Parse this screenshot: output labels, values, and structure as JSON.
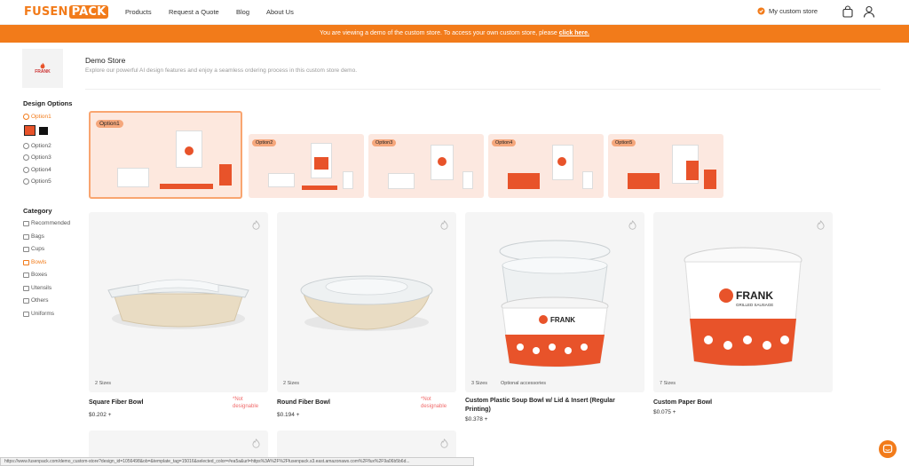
{
  "header": {
    "logo_part1": "FUSEN",
    "logo_part2": "PACK",
    "nav": [
      "Products",
      "Request a Quote",
      "Blog",
      "About Us"
    ],
    "my_store": "My custom store"
  },
  "banner": {
    "text": "You are viewing a demo of the custom store. To access your own custom store, please ",
    "link": "click here."
  },
  "store": {
    "logo_text": "FRANK",
    "title": "Demo Store",
    "subtitle": "Explore our powerful AI design features and enjoy a seamless ordering process in this custom store demo."
  },
  "sidebar": {
    "design_heading": "Design Options",
    "options": [
      "Option1",
      "Option2",
      "Option3",
      "Option4",
      "Option5"
    ],
    "swatches": [
      "#e8532a",
      "#111111"
    ],
    "category_heading": "Category",
    "categories": [
      "Recommended",
      "Bags",
      "Cups",
      "Bowls",
      "Boxes",
      "Utensils",
      "Others",
      "Uniforms"
    ],
    "active_category": "Bowls"
  },
  "designs": [
    "Option1",
    "Option2",
    "Option3",
    "Option4",
    "Option5"
  ],
  "products": [
    {
      "name": "Square Fiber Bowl",
      "price": "$0.202 +",
      "sizes": "2 Sizes",
      "note1": "*Not",
      "note2": "designable"
    },
    {
      "name": "Round Fiber Bowl",
      "price": "$0.194 +",
      "sizes": "2 Sizes",
      "note1": "*Not",
      "note2": "designable"
    },
    {
      "name": "Custom Plastic Soup Bowl w/ Lid & Insert (Regular",
      "name2": "Printing)",
      "price": "$0.378 +",
      "sizes": "3 Sizes",
      "accessories": "Optional accessories"
    },
    {
      "name": "Custom Paper Bowl",
      "price": "$0.075 +",
      "sizes": "7 Sizes"
    }
  ],
  "product_brand": "FRANK",
  "product_brand_sub": "GRILLED SAUSAGE",
  "status_url": "https://www.fusenpack.com/demo_custom-store?design_id=1056498&ob=&template_tag=15016&selected_color=#ea5a&url=https%3A%2F%2Ffusenpack.s3.east.amazonaws.com%2Fflux%2F9a06b5b6d..."
}
